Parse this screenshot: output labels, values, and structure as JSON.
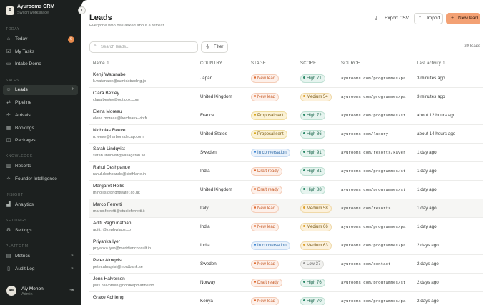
{
  "workspace": {
    "logo": "A",
    "name": "Ayurooms CRM",
    "subtitle": "Switch workspace"
  },
  "sidebar": {
    "sections": {
      "today": "TODAY",
      "sales": "SALES",
      "knowledge": "KNOWLEDGE",
      "insight": "INSIGHT",
      "settings": "SETTINGS",
      "platform": "PLATFORM"
    },
    "items": {
      "today": {
        "label": "Today",
        "badge": "6"
      },
      "tasks": {
        "label": "My Tasks"
      },
      "intake": {
        "label": "Intake Demo"
      },
      "leads": {
        "label": "Leads"
      },
      "pipeline": {
        "label": "Pipeline"
      },
      "arrivals": {
        "label": "Arrivals"
      },
      "bookings": {
        "label": "Bookings"
      },
      "packages": {
        "label": "Packages"
      },
      "resorts": {
        "label": "Resorts"
      },
      "founder": {
        "label": "Founder Intelligence"
      },
      "analytics": {
        "label": "Analytics"
      },
      "settings": {
        "label": "Settings"
      },
      "metrics": {
        "label": "Metrics"
      },
      "audit": {
        "label": "Audit Log"
      }
    },
    "user": {
      "initials": "AM",
      "name": "Aiy Menon",
      "role": "Admin"
    }
  },
  "header": {
    "title": "Leads",
    "subtitle": "Everyone who has asked about a retreat",
    "export_label": "Export CSV",
    "import_label": "Import",
    "new_label": "New lead"
  },
  "toolbar": {
    "search_placeholder": "Search leads...",
    "filter_label": "Filter",
    "count": "20 leads"
  },
  "table": {
    "headers": {
      "name": "Name",
      "country": "COUNTRY",
      "stage": "STAGE",
      "score": "SCORE",
      "source": "SOURCE",
      "activity": "Last activity"
    },
    "rows": [
      {
        "name": "Kenji Watanabe",
        "email": "k.watanabe@sumidatrading.jp",
        "country": "Japan",
        "stage": "New lead",
        "stage_type": "new",
        "score": "High 71",
        "score_type": "high",
        "source": "ayurooms.com/programmes/pa",
        "activity": "3 minutes ago"
      },
      {
        "name": "Clara Bexley",
        "email": "clara.bexley@outlook.com",
        "country": "United Kingdom",
        "stage": "New lead",
        "stage_type": "new",
        "score": "Medium 54",
        "score_type": "medium",
        "source": "ayurooms.com/programmes/pa",
        "activity": "3 minutes ago"
      },
      {
        "name": "Elena Moreau",
        "email": "elena.moreau@bordeaux-vin.fr",
        "country": "France",
        "stage": "Proposal sent",
        "stage_type": "proposal",
        "score": "High 72",
        "score_type": "high",
        "source": "ayurooms.com/programmes/st",
        "activity": "about 12 hours ago"
      },
      {
        "name": "Nicholas Reeve",
        "email": "n.reeve@harborsidecap.com",
        "country": "United States",
        "stage": "Proposal sent",
        "stage_type": "proposal",
        "score": "High 86",
        "score_type": "high",
        "source": "ayurooms.com/luxury",
        "activity": "about 14 hours ago"
      },
      {
        "name": "Sarah Lindqvist",
        "email": "sarah.lindqvist@vasagatan.se",
        "country": "Sweden",
        "stage": "In conversation",
        "stage_type": "conv",
        "score": "High 91",
        "score_type": "high",
        "source": "ayurooms.com/resorts/kaver",
        "activity": "1 day ago"
      },
      {
        "name": "Rahul Deshpande",
        "email": "rahul.deshpande@sixthlane.in",
        "country": "India",
        "stage": "Draft ready",
        "stage_type": "draft",
        "score": "High 81",
        "score_type": "high",
        "source": "ayurooms.com/programmes/st",
        "activity": "1 day ago"
      },
      {
        "name": "Margaret Hollis",
        "email": "m.hollis@brightwater.co.uk",
        "country": "United Kingdom",
        "stage": "Draft ready",
        "stage_type": "draft",
        "score": "High 88",
        "score_type": "high",
        "source": "ayurooms.com/programmes/st",
        "activity": "1 day ago"
      },
      {
        "name": "Marco Ferretti",
        "email": "marco.ferretti@studioferretti.it",
        "country": "Italy",
        "stage": "New lead",
        "stage_type": "new",
        "score": "Medium 58",
        "score_type": "medium",
        "source": "ayurooms.com/resorts",
        "activity": "1 day ago"
      },
      {
        "name": "Aditi Raghunathan",
        "email": "aditi.r@zephyrlabs.co",
        "country": "India",
        "stage": "New lead",
        "stage_type": "new",
        "score": "Medium 66",
        "score_type": "medium",
        "source": "ayurooms.com/programmes/pa",
        "activity": "1 day ago"
      },
      {
        "name": "Priyanka Iyer",
        "email": "priyanka.iyer@meridianconsult.in",
        "country": "India",
        "stage": "In conversation",
        "stage_type": "conv",
        "score": "Medium 63",
        "score_type": "medium",
        "source": "ayurooms.com/programmes/pa",
        "activity": "2 days ago"
      },
      {
        "name": "Peter Almqvist",
        "email": "peter.almqvist@nordbank.se",
        "country": "Sweden",
        "stage": "New lead",
        "stage_type": "new",
        "score": "Low 37",
        "score_type": "low",
        "source": "ayurooms.com/contact",
        "activity": "2 days ago"
      },
      {
        "name": "Jens Halvorsen",
        "email": "jens.halvorsen@nordkapmarine.no",
        "country": "Norway",
        "stage": "Draft ready",
        "stage_type": "draft",
        "score": "High 76",
        "score_type": "high",
        "source": "ayurooms.com/programmes/st",
        "activity": "2 days ago"
      },
      {
        "name": "Grace Achieng",
        "email": "",
        "country": "Kenya",
        "stage": "New lead",
        "stage_type": "new",
        "score": "High 70",
        "score_type": "high",
        "source": "ayurooms.com/programmes/pa",
        "activity": "2 days ago"
      }
    ]
  }
}
